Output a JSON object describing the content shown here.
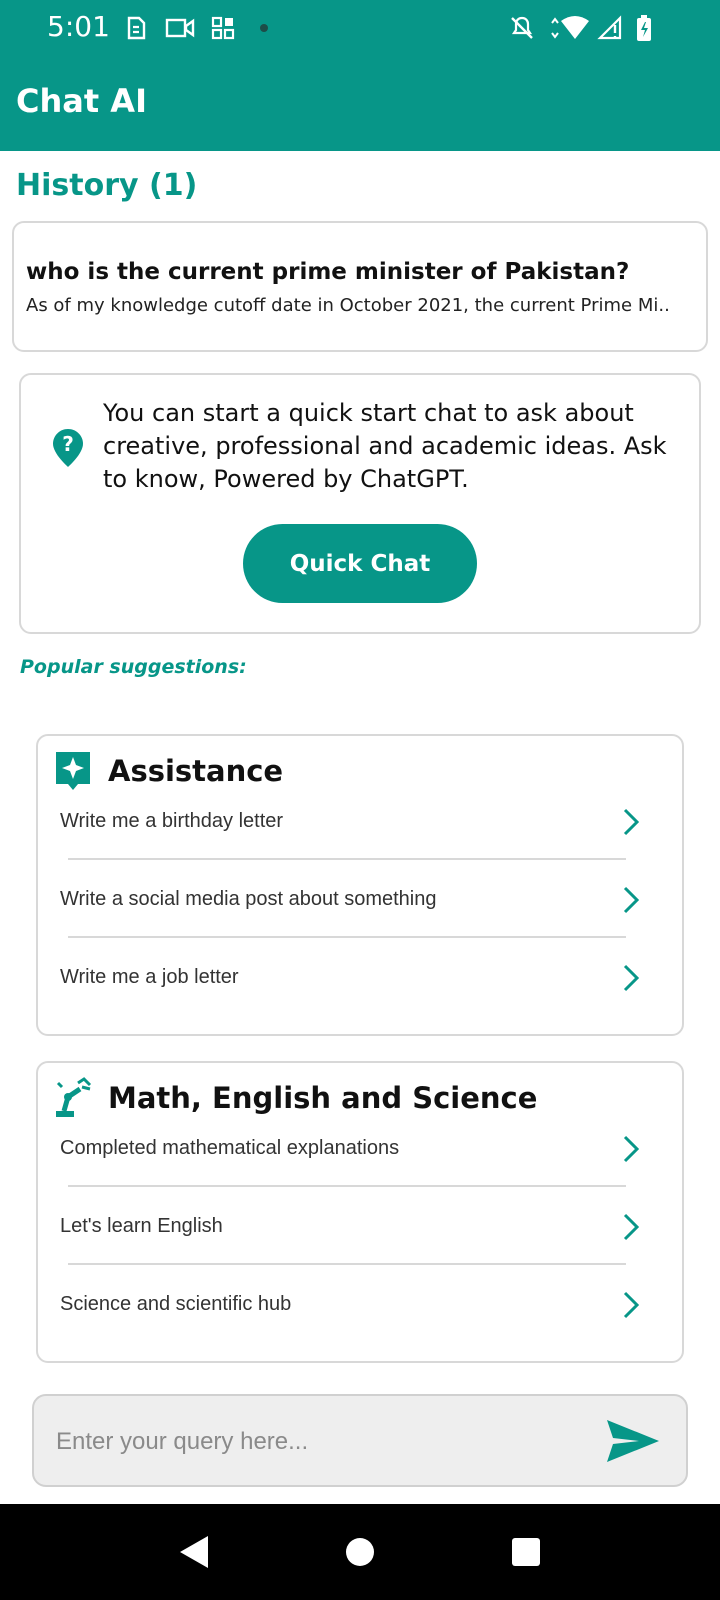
{
  "status_bar": {
    "time": "5:01",
    "icons": [
      "sim-card-icon",
      "video-icon",
      "apps-icon",
      "dot-icon",
      "mute-icon",
      "wifi-icon",
      "signal-icon",
      "battery-icon"
    ]
  },
  "app_bar": {
    "title": "Chat AI"
  },
  "history": {
    "title": "History (1)",
    "items": [
      {
        "question": "who is the current prime minister of Pakistan?",
        "answer": "As of my knowledge cutoff date in October 2021, the current Prime Mi.."
      }
    ]
  },
  "quick_start": {
    "text": "You can start a quick start chat to ask about creative, professional and academic ideas. Ask to know, Powered by ChatGPT.",
    "button_label": "Quick Chat",
    "icon": "help-pin-icon"
  },
  "popular_label": "Popular suggestions:",
  "suggestion_groups": [
    {
      "title": "Assistance",
      "icon": "sparkle-chat-icon",
      "items": [
        {
          "label": "Write me a birthday letter"
        },
        {
          "label": "Write a social media post about something"
        },
        {
          "label": "Write me a job letter"
        }
      ]
    },
    {
      "title": "Math, English and Science",
      "icon": "robot-arm-icon",
      "items": [
        {
          "label": "Completed mathematical explanations"
        },
        {
          "label": "Let's learn English"
        },
        {
          "label": "Science and scientific hub"
        }
      ]
    }
  ],
  "query": {
    "value": "",
    "placeholder": "Enter your query here..."
  },
  "colors": {
    "primary": "#079688",
    "card_border": "#d8d8d8",
    "input_background": "#eeeeee"
  }
}
